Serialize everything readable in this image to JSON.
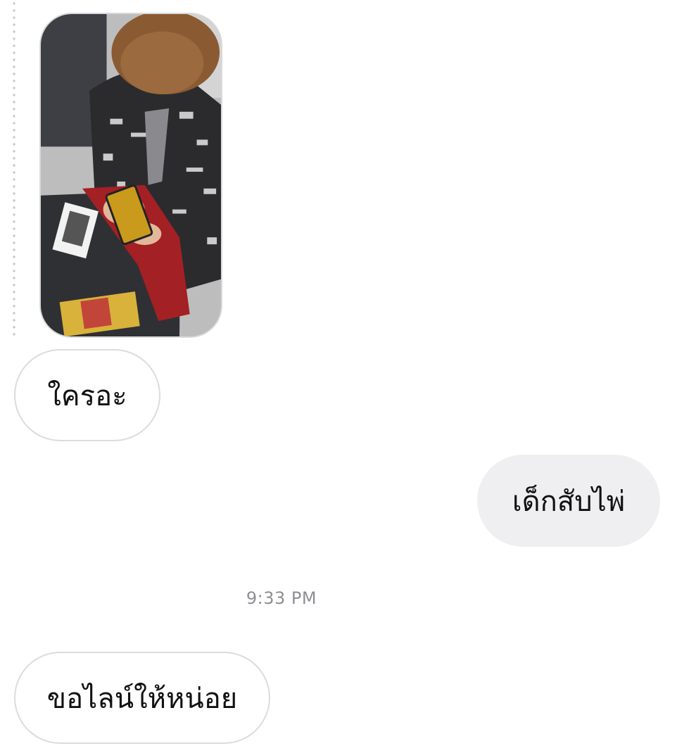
{
  "thread": {
    "messages": [
      {
        "direction": "incoming",
        "type": "image",
        "icon": "photo-of-person-shuffling-cards"
      },
      {
        "direction": "incoming",
        "type": "text",
        "text": "ใครอะ"
      },
      {
        "direction": "outgoing",
        "type": "text",
        "text": "เด็กสับไพ่"
      },
      {
        "direction": "incoming",
        "type": "text",
        "text": "ขอไลน์ให้หน่อย"
      }
    ],
    "timestamp": "9:33 PM"
  },
  "colors": {
    "incoming_bubble_bg": "#ffffff",
    "incoming_bubble_border": "#dcdce0",
    "outgoing_bubble_bg": "#efeff2",
    "timestamp_text": "#8e8e93"
  }
}
